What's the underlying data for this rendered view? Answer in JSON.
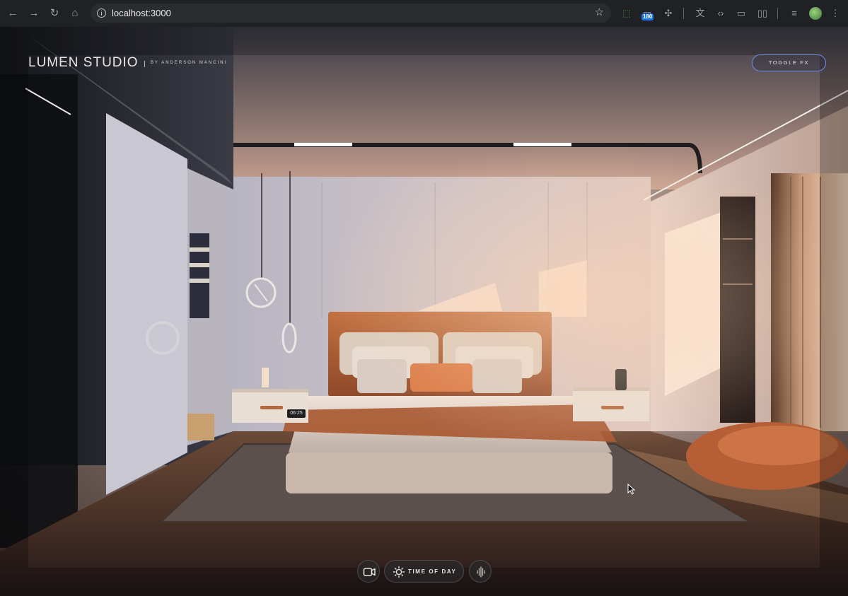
{
  "browser": {
    "url": "localhost:3000",
    "extension_badge": "180"
  },
  "site": {
    "brand": "LUMEN STUDIO",
    "byline": "BY ANDERSON MANCINI",
    "toggle_fx_label": "TOGGLE FX"
  },
  "scene": {
    "bedside_clock": "06:25"
  },
  "dock": {
    "camera_icon": "video-camera-icon",
    "time_of_day_icon": "sun-icon",
    "time_of_day_label": "TIME OF DAY",
    "sound_icon": "sound-wave-icon"
  },
  "colors": {
    "accent_outline": "#6e8de6",
    "dock_bg": "#2a282a",
    "bed_orange": "#b5653a"
  }
}
